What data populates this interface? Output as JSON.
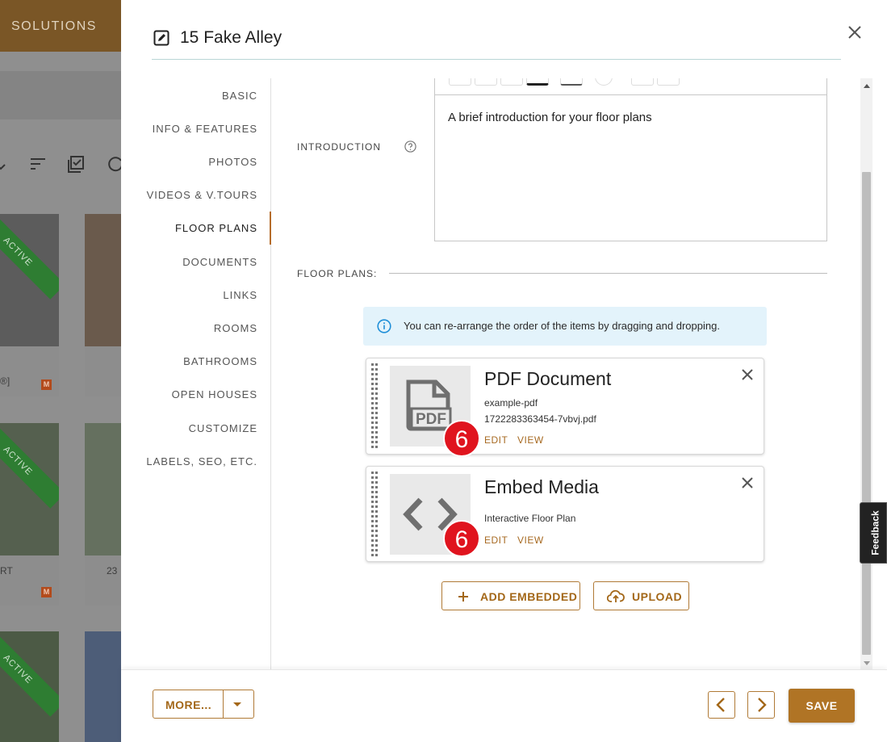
{
  "background": {
    "topbar_label": "SOLUTIONS",
    "ribbon_label": "ACTIVE",
    "card_badge": "M",
    "card_text_1": "®]",
    "card_text_2": "RT",
    "card_text_3": "23"
  },
  "modal": {
    "title": "15 Fake Alley"
  },
  "nav": {
    "items": [
      {
        "label": "BASIC"
      },
      {
        "label": "INFO & FEATURES"
      },
      {
        "label": "PHOTOS"
      },
      {
        "label": "VIDEOS & V.TOURS"
      },
      {
        "label": "FLOOR PLANS",
        "active": true
      },
      {
        "label": "DOCUMENTS"
      },
      {
        "label": "LINKS"
      },
      {
        "label": "ROOMS"
      },
      {
        "label": "BATHROOMS"
      },
      {
        "label": "OPEN HOUSES"
      },
      {
        "label": "CUSTOMIZE"
      },
      {
        "label": "LABELS, SEO, ETC."
      }
    ]
  },
  "introduction": {
    "label": "INTRODUCTION",
    "text": "A brief introduction for your floor plans"
  },
  "floor_plans": {
    "label": "FLOOR PLANS:",
    "info": "You can re-arrange the order of the items by dragging and dropping.",
    "items": [
      {
        "title": "PDF Document",
        "line1": "example-pdf",
        "line2": "1722283363454-7vbvj.pdf",
        "thumb_icon": "pdf-file-icon",
        "thumb_text": "PDF",
        "edit": "EDIT",
        "view": "VIEW",
        "badge": "6"
      },
      {
        "title": "Embed Media",
        "line1": "Interactive Floor Plan",
        "thumb_icon": "code-embed-icon",
        "edit": "EDIT",
        "view": "VIEW",
        "badge": "6"
      }
    ],
    "add_embedded": "ADD EMBEDDED",
    "upload": "UPLOAD"
  },
  "feedback": "Feedback",
  "footer": {
    "more": "MORE...",
    "save": "SAVE"
  },
  "colors": {
    "accent": "#b07425",
    "active_ribbon": "#2e7d32",
    "step_badge": "#e0141e",
    "info_bg": "#e3f3fb"
  }
}
